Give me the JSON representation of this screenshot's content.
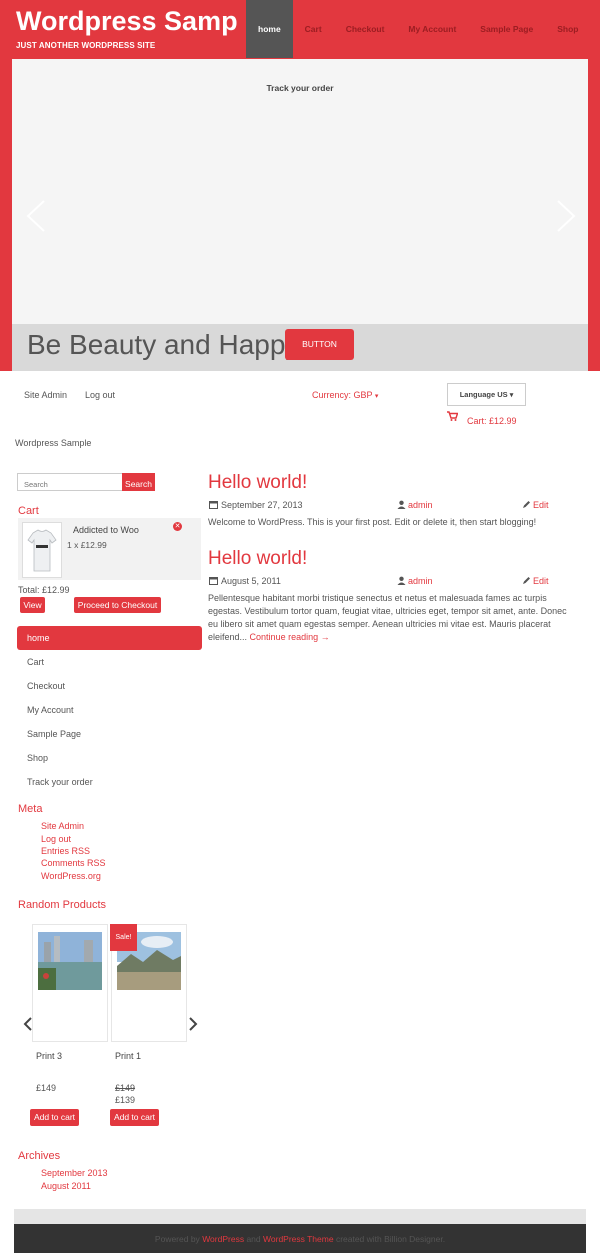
{
  "site": {
    "title": "Wordpress Samp",
    "tagline": "JUST ANOTHER WORDPRESS SITE"
  },
  "topnav": [
    {
      "label": "home",
      "active": true
    },
    {
      "label": "Cart"
    },
    {
      "label": "Checkout"
    },
    {
      "label": "My Account"
    },
    {
      "label": "Sample Page"
    },
    {
      "label": "Shop"
    }
  ],
  "slider": {
    "title": "Track your order",
    "caption": "Be Beauty and Happy",
    "button_label": "BUTTON"
  },
  "utility": {
    "site_admin": "Site Admin",
    "log_out": "Log out",
    "currency": "Currency: GBP",
    "language": "Language US",
    "cart_total": "Cart: £12.99"
  },
  "breadcrumb": "Wordpress Sample",
  "search": {
    "placeholder": "Search",
    "button_label": "Search"
  },
  "cart_widget": {
    "title": "Cart",
    "item_name": "Addicted to Woo",
    "item_qty": "1 x £12.99",
    "total": "Total: £12.99",
    "view_label": "View",
    "checkout_label": "Proceed to Checkout"
  },
  "sidenav": [
    {
      "label": "home",
      "active": true
    },
    {
      "label": "Cart"
    },
    {
      "label": "Checkout"
    },
    {
      "label": "My Account"
    },
    {
      "label": "Sample Page"
    },
    {
      "label": "Shop"
    },
    {
      "label": "Track your order"
    }
  ],
  "meta": {
    "title": "Meta",
    "links": [
      "Site Admin",
      "Log out",
      "Entries RSS",
      "Comments RSS",
      "WordPress.org"
    ]
  },
  "random_products": {
    "title": "Random Products",
    "products": [
      {
        "name": "Print 3",
        "price": "£149",
        "sale_price": "",
        "add_label": "Add to cart"
      },
      {
        "name": "Print 1",
        "price": "£149",
        "sale_price": "£139",
        "add_label": "Add to cart",
        "badge": "Sale!"
      }
    ]
  },
  "archives": {
    "title": "Archives",
    "links": [
      "September 2013",
      "August 2011"
    ]
  },
  "posts": [
    {
      "title": "Hello world!",
      "date": "September 27, 2013",
      "author": "admin",
      "edit": "Edit",
      "body": "Welcome to WordPress. This is your first post. Edit or delete it, then start blogging!",
      "more": ""
    },
    {
      "title": "Hello world!",
      "date": "August 5, 2011",
      "author": "admin",
      "edit": "Edit",
      "body": "Pellentesque habitant morbi tristique senectus et netus et malesuada fames ac turpis egestas. Vestibulum tortor quam, feugiat vitae, ultricies eget, tempor sit amet, ante. Donec eu libero sit amet quam egestas semper. Aenean ultricies mi vitae est. Mauris placerat eleifend...",
      "more": "Continue reading →"
    }
  ],
  "footer": {
    "powered_by": "Powered by",
    "wordpress": "WordPress",
    "and": "and",
    "wp_theme": "WordPress Theme",
    "created": "created with Billion Designer."
  },
  "colors": {
    "accent": "#e2383f",
    "dark": "#333333",
    "nav_active": "#555555"
  }
}
